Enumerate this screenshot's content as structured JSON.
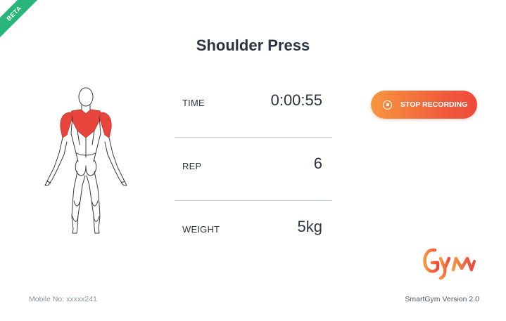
{
  "ribbon": {
    "label": "BETA"
  },
  "exercise": {
    "title": "Shoulder Press"
  },
  "stats": {
    "time": {
      "label": "TIME",
      "value": "0:00:55"
    },
    "rep": {
      "label": "REP",
      "value": "6"
    },
    "weight": {
      "label": "WEIGHT",
      "value": "5kg"
    }
  },
  "actions": {
    "stop_label": "STOP RECORDING",
    "stop_icon": "stop-circle-icon"
  },
  "footer": {
    "mobile": "Mobile No: xxxxx241",
    "version": "SmartGym Version 2.0"
  },
  "colors": {
    "accent_start": "#f7963f",
    "accent_end": "#ee4a3b",
    "muscle_highlight": "#e8453c",
    "beta_ribbon": "#29b67a"
  }
}
